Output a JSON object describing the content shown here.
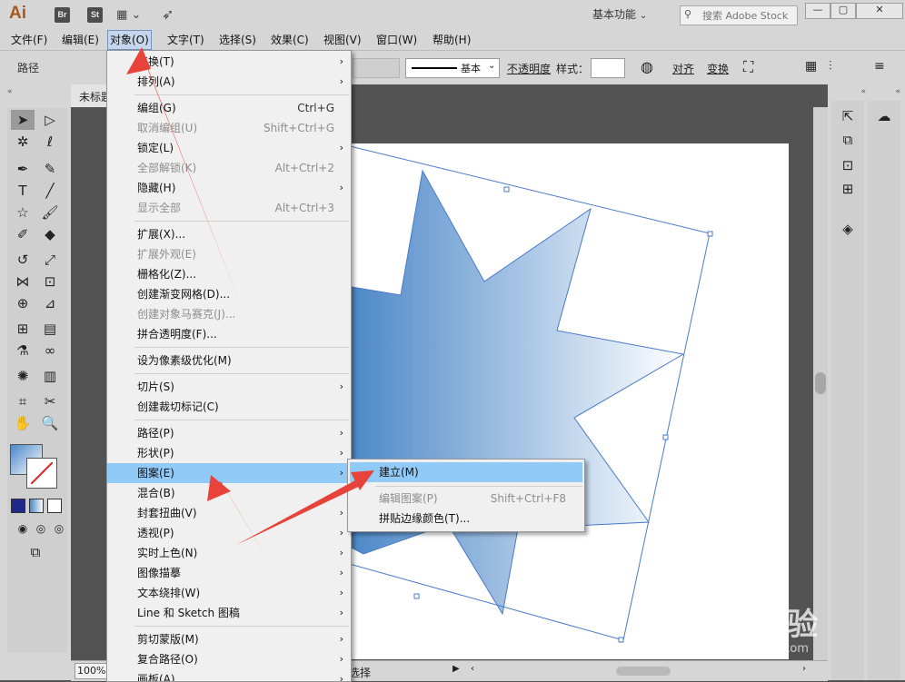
{
  "app": {
    "logo": "Ai",
    "badges": [
      "Br",
      "St"
    ],
    "workspace": "基本功能",
    "search_placeholder": "搜索 Adobe Stock",
    "window_buttons": [
      "—",
      "▢",
      "✕"
    ]
  },
  "menubar": [
    "文件(F)",
    "编辑(E)",
    "对象(O)",
    "文字(T)",
    "选择(S)",
    "效果(C)",
    "视图(V)",
    "窗口(W)",
    "帮助(H)"
  ],
  "control_bar": {
    "selection_label": "路径",
    "stroke_label": "基本",
    "opacity_label": "不透明度",
    "style_label": "样式：",
    "align_label": "对齐",
    "transform_label": "变换"
  },
  "document": {
    "tab_title": "未标题",
    "zoom": "100%",
    "status_text": "选择"
  },
  "object_menu": [
    {
      "label": "变换(T)",
      "shortcut": "",
      "submenu": true,
      "disabled": false
    },
    {
      "label": "排列(A)",
      "shortcut": "",
      "submenu": true,
      "disabled": false
    },
    {
      "label": "编组(G)",
      "shortcut": "Ctrl+G",
      "submenu": false,
      "disabled": false
    },
    {
      "label": "取消编组(U)",
      "shortcut": "Shift+Ctrl+G",
      "submenu": false,
      "disabled": true
    },
    {
      "label": "锁定(L)",
      "shortcut": "",
      "submenu": true,
      "disabled": false
    },
    {
      "label": "全部解锁(K)",
      "shortcut": "Alt+Ctrl+2",
      "submenu": false,
      "disabled": true
    },
    {
      "label": "隐藏(H)",
      "shortcut": "",
      "submenu": true,
      "disabled": false
    },
    {
      "label": "显示全部",
      "shortcut": "Alt+Ctrl+3",
      "submenu": false,
      "disabled": true
    },
    {
      "label": "扩展(X)...",
      "shortcut": "",
      "submenu": false,
      "disabled": false
    },
    {
      "label": "扩展外观(E)",
      "shortcut": "",
      "submenu": false,
      "disabled": true
    },
    {
      "label": "栅格化(Z)...",
      "shortcut": "",
      "submenu": false,
      "disabled": false
    },
    {
      "label": "创建渐变网格(D)...",
      "shortcut": "",
      "submenu": false,
      "disabled": false
    },
    {
      "label": "创建对象马赛克(J)...",
      "shortcut": "",
      "submenu": false,
      "disabled": true
    },
    {
      "label": "拼合透明度(F)...",
      "shortcut": "",
      "submenu": false,
      "disabled": false
    },
    {
      "label": "设为像素级优化(M)",
      "shortcut": "",
      "submenu": false,
      "disabled": false
    },
    {
      "label": "切片(S)",
      "shortcut": "",
      "submenu": true,
      "disabled": false
    },
    {
      "label": "创建裁切标记(C)",
      "shortcut": "",
      "submenu": false,
      "disabled": false
    },
    {
      "label": "路径(P)",
      "shortcut": "",
      "submenu": true,
      "disabled": false
    },
    {
      "label": "形状(P)",
      "shortcut": "",
      "submenu": true,
      "disabled": false
    },
    {
      "label": "图案(E)",
      "shortcut": "",
      "submenu": true,
      "disabled": false,
      "highlighted": true
    },
    {
      "label": "混合(B)",
      "shortcut": "",
      "submenu": true,
      "disabled": false
    },
    {
      "label": "封套扭曲(V)",
      "shortcut": "",
      "submenu": true,
      "disabled": false
    },
    {
      "label": "透视(P)",
      "shortcut": "",
      "submenu": true,
      "disabled": false
    },
    {
      "label": "实时上色(N)",
      "shortcut": "",
      "submenu": true,
      "disabled": false
    },
    {
      "label": "图像描摹",
      "shortcut": "",
      "submenu": true,
      "disabled": false
    },
    {
      "label": "文本绕排(W)",
      "shortcut": "",
      "submenu": true,
      "disabled": false
    },
    {
      "label": "Line 和 Sketch 图稿",
      "shortcut": "",
      "submenu": true,
      "disabled": false
    },
    {
      "label": "剪切蒙版(M)",
      "shortcut": "",
      "submenu": true,
      "disabled": false
    },
    {
      "label": "复合路径(O)",
      "shortcut": "",
      "submenu": true,
      "disabled": false
    },
    {
      "label": "画板(A)",
      "shortcut": "",
      "submenu": true,
      "disabled": false
    }
  ],
  "pattern_submenu": [
    {
      "label": "建立(M)",
      "shortcut": "",
      "disabled": false,
      "highlighted": true
    },
    {
      "label": "编辑图案(P)",
      "shortcut": "Shift+Ctrl+F8",
      "disabled": true
    },
    {
      "label": "拼贴边缘颜色(T)...",
      "shortcut": "",
      "disabled": false
    }
  ],
  "watermark": {
    "brand": "Bai 经验",
    "url": "jingyan.baidu.com"
  },
  "colors": {
    "annotation_arrow": "#e8433a",
    "menu_highlight": "#91c9f7",
    "gradient_start": "#4a86c8",
    "gradient_end": "#ffffff"
  }
}
